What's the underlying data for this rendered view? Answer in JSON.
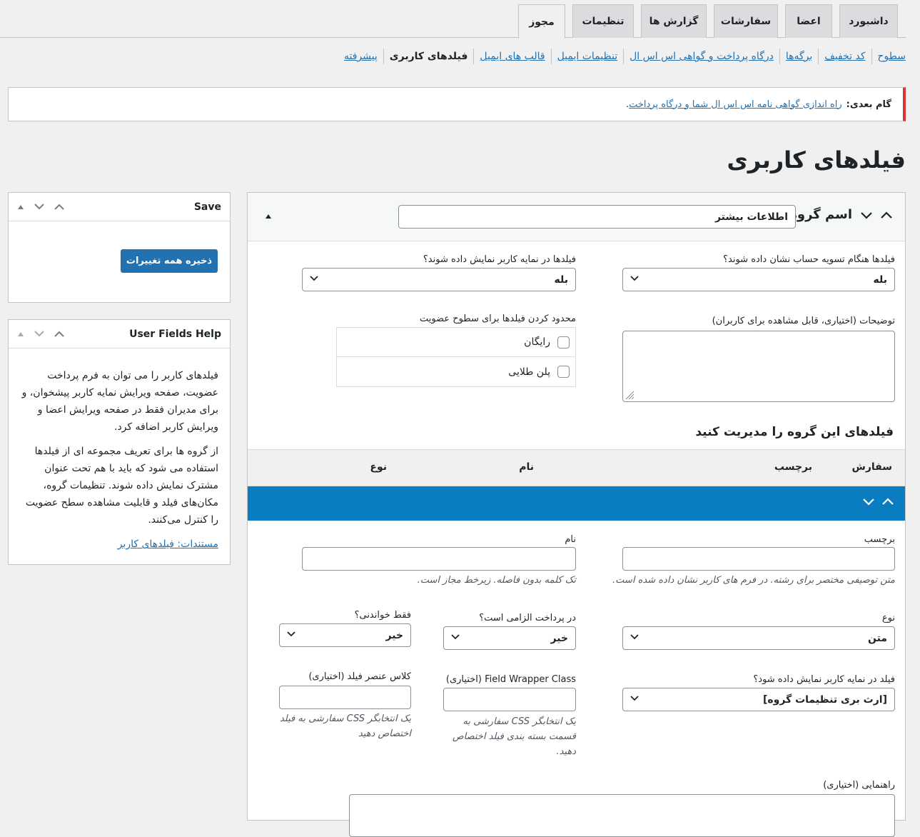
{
  "tabs": [
    {
      "label": "داشبورد",
      "active": false
    },
    {
      "label": "اعضا",
      "active": false
    },
    {
      "label": "سفارشات",
      "active": false
    },
    {
      "label": "گزارش ها",
      "active": false
    },
    {
      "label": "تنظیمات",
      "active": false
    },
    {
      "label": "مجوز",
      "active": true
    }
  ],
  "subnav": [
    {
      "label": "سطوح",
      "current": false
    },
    {
      "label": "کد تخفیف",
      "current": false
    },
    {
      "label": "برگه‌ها",
      "current": false
    },
    {
      "label": "درگاه پرداخت و گواهی اس اس ال",
      "current": false
    },
    {
      "label": "تنظیمات ایمیل",
      "current": false
    },
    {
      "label": "قالب های ایمیل",
      "current": false
    },
    {
      "label": "فیلدهای کاربری",
      "current": true
    },
    {
      "label": "پیشرفته",
      "current": false
    }
  ],
  "notice": {
    "prefix": "گام بعدی:",
    "link": "راه اندازی گواهی نامه اس اس ال شما و درگاه پرداخت",
    "suffix": "."
  },
  "page_title": "فیلدهای کاربری",
  "save_box": {
    "title": "Save",
    "button": "ذخیره همه تغییرات"
  },
  "help_box": {
    "title": "User Fields Help",
    "para1": "فیلدهای کاربر را می توان به فرم پرداخت عضویت، صفحه ویرایش نمایه کاربر پیشخوان، و برای مدیران فقط در صفحه ویرایش اعضا و ویرایش کاربر اضافه کرد.",
    "para2": "از گروه ها برای تعریف مجموعه ای از فیلدها استفاده می شود که باید با هم تحت عنوان مشترک نمایش داده شوند. تنظیمات گروه، مکان‌های فیلد و قابلیت مشاهده سطح عضویت را کنترل می‌کنند.",
    "doc_link": "مستندات: فیلدهای کاربر"
  },
  "group": {
    "name_label": "اسم گروه",
    "name_value": "اطلاعات بیشتر",
    "checkout_label": "فیلدها هنگام تسویه حساب نشان داده شوند؟",
    "checkout_value": "بله",
    "profile_label": "فیلدها در نمایه کاربر نمایش داده شوند؟",
    "profile_value": "بله",
    "description_label": "توضیحات (اختیاری، قابل مشاهده برای کاربران)",
    "restrict_label": "محدود کردن فیلدها برای سطوح عضویت",
    "levels": [
      "رایگان",
      "پلن طلایی"
    ],
    "manage_title": "فیلدهای این گروه را مدیریت کنید",
    "columns": {
      "order": "سفارش",
      "label": "برچسب",
      "name": "نام",
      "type": "نوع"
    }
  },
  "field": {
    "label_label": "برچسب",
    "label_desc": "متن توصیفی مختصر برای رشته. در فرم های کاربر نشان داده شده است.",
    "name_label": "نام",
    "name_desc": "تک کلمه بدون فاصله. زیرخط مجاز است.",
    "type_label": "نوع",
    "type_value": "متن",
    "required_label": "در پرداخت الزامی است؟",
    "required_value": "خیر",
    "readonly_label": "فقط خواندنی؟",
    "readonly_value": "خیر",
    "profile_label": "فیلد در نمایه کاربر نمایش داده شود؟",
    "profile_value": "[ارث بری تنظیمات گروه]",
    "wrapper_label": "Field Wrapper Class (اختیاری)",
    "wrapper_desc": "یک انتخابگر CSS سفارشی به قسمت بسته بندی فیلد اختصاص دهید.",
    "element_label": "کلاس عنصر فیلد (اختیاری)",
    "element_desc": "یک انتخابگر CSS سفارشی به فیلد اختصاص دهید",
    "hint_label": "راهنمایی (اختیاری)"
  }
}
